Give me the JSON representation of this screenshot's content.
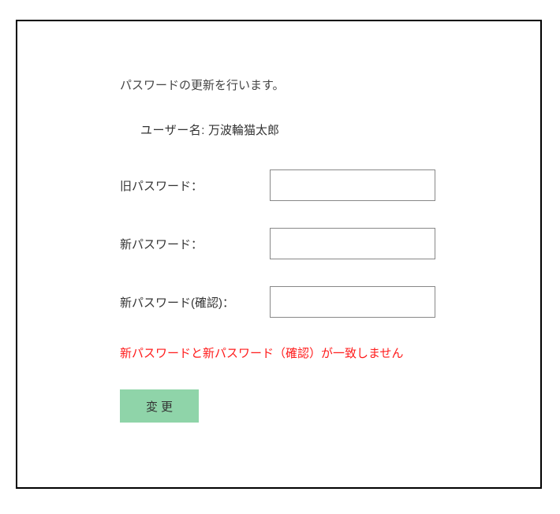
{
  "heading": "パスワードの更新を行います。",
  "username": {
    "label": "ユーザー名:",
    "value": "万波輪猫太郎"
  },
  "fields": {
    "old_password": {
      "label": "旧パスワード：",
      "value": ""
    },
    "new_password": {
      "label": "新パスワード：",
      "value": ""
    },
    "new_password_confirm": {
      "label": "新パスワード(確認)：",
      "value": ""
    }
  },
  "error_message": "新パスワードと新パスワード（確認）が一致しません",
  "submit_label": "変更"
}
